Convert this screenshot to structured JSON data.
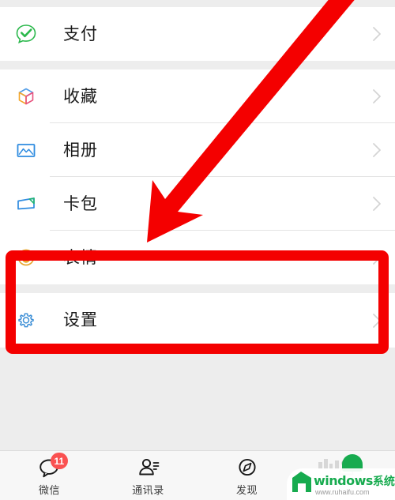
{
  "app": {
    "name": "WeChat",
    "screen": "me-profile-menu"
  },
  "colors": {
    "page_background": "#ededed",
    "row_background": "#ffffff",
    "separator": "#e4e4e4",
    "label_text": "#1a1a1a",
    "annotation_red": "#f40000",
    "badge_red": "#fa5151",
    "tabbar_background": "#f7f7f7",
    "watermark_green": "#17ab4f"
  },
  "list": {
    "groups": [
      {
        "id": "group-pay",
        "rows": [
          {
            "id": "pay",
            "label": "支付",
            "icon": "wechat-pay-icon",
            "chevron": "chevron-right-icon"
          }
        ]
      },
      {
        "id": "group-content",
        "rows": [
          {
            "id": "favorites",
            "label": "收藏",
            "icon": "favorites-cube-icon",
            "chevron": "chevron-right-icon"
          },
          {
            "id": "album",
            "label": "相册",
            "icon": "photo-album-icon",
            "chevron": "chevron-right-icon"
          },
          {
            "id": "cards",
            "label": "卡包",
            "icon": "card-wallet-icon",
            "chevron": "chevron-right-icon"
          },
          {
            "id": "stickers",
            "label": "表情",
            "icon": "sticker-smiley-icon",
            "chevron": "chevron-right-icon"
          }
        ]
      },
      {
        "id": "group-settings",
        "rows": [
          {
            "id": "settings",
            "label": "设置",
            "icon": "settings-gear-icon",
            "chevron": "chevron-right-icon"
          }
        ]
      }
    ]
  },
  "tabbar": {
    "tabs": [
      {
        "id": "chats",
        "label": "微信",
        "icon": "chat-bubble-icon",
        "badge": "11",
        "active": false
      },
      {
        "id": "contacts",
        "label": "通讯录",
        "icon": "contacts-person-icon",
        "badge": "",
        "active": false
      },
      {
        "id": "discover",
        "label": "发现",
        "icon": "discover-compass-icon",
        "badge": "",
        "active": false
      },
      {
        "id": "me",
        "label": "",
        "icon": "me-person-icon",
        "badge": "",
        "active": true
      }
    ]
  },
  "annotations": {
    "highlight_box": {
      "id": "settings-highlight-box",
      "target": "设置",
      "color": "#f40000"
    },
    "arrow": {
      "id": "pointer-arrow",
      "direction": "down-left",
      "target": "设置",
      "color": "#f40000"
    }
  },
  "watermark": {
    "brand": "windows",
    "brand_cn": "系统家园",
    "url": "www.ruhaifu.com"
  }
}
